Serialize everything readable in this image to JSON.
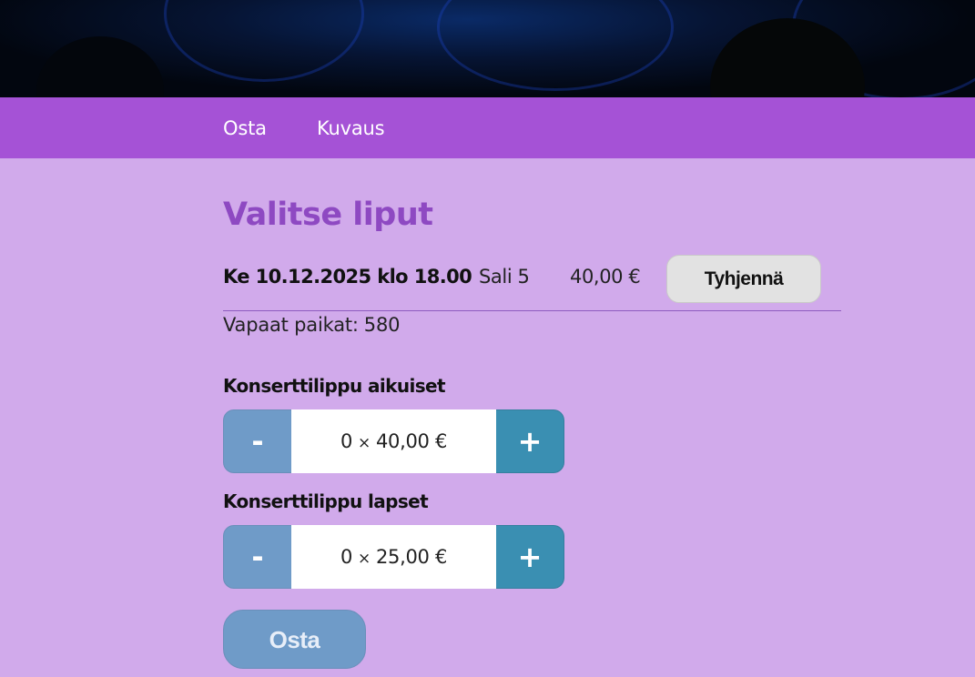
{
  "nav": {
    "items": [
      {
        "label": "Osta"
      },
      {
        "label": "Kuvaus"
      }
    ]
  },
  "page": {
    "title": "Valitse liput"
  },
  "event": {
    "date": "Ke 10.12.2025 klo 18.00",
    "hall": "Sali 5",
    "price": "40,00 €",
    "clear_label": "Tyhjennä"
  },
  "seats": {
    "label": "Vapaat paikat:",
    "count": "580"
  },
  "tickets": [
    {
      "label": "Konserttilippu aikuiset",
      "minus": "-",
      "plus": "+",
      "quantity": "0",
      "times": "×",
      "unit_price": "40,00 €"
    },
    {
      "label": "Konserttilippu lapset",
      "minus": "-",
      "plus": "+",
      "quantity": "0",
      "times": "×",
      "unit_price": "25,00 €"
    }
  ],
  "buy": {
    "label": "Osta"
  },
  "colors": {
    "background": "#d1aaeb",
    "navbar": "#a552d6",
    "title": "#8e49c2",
    "minus_button": "#6f9bc8",
    "plus_button": "#3a8fb2"
  }
}
